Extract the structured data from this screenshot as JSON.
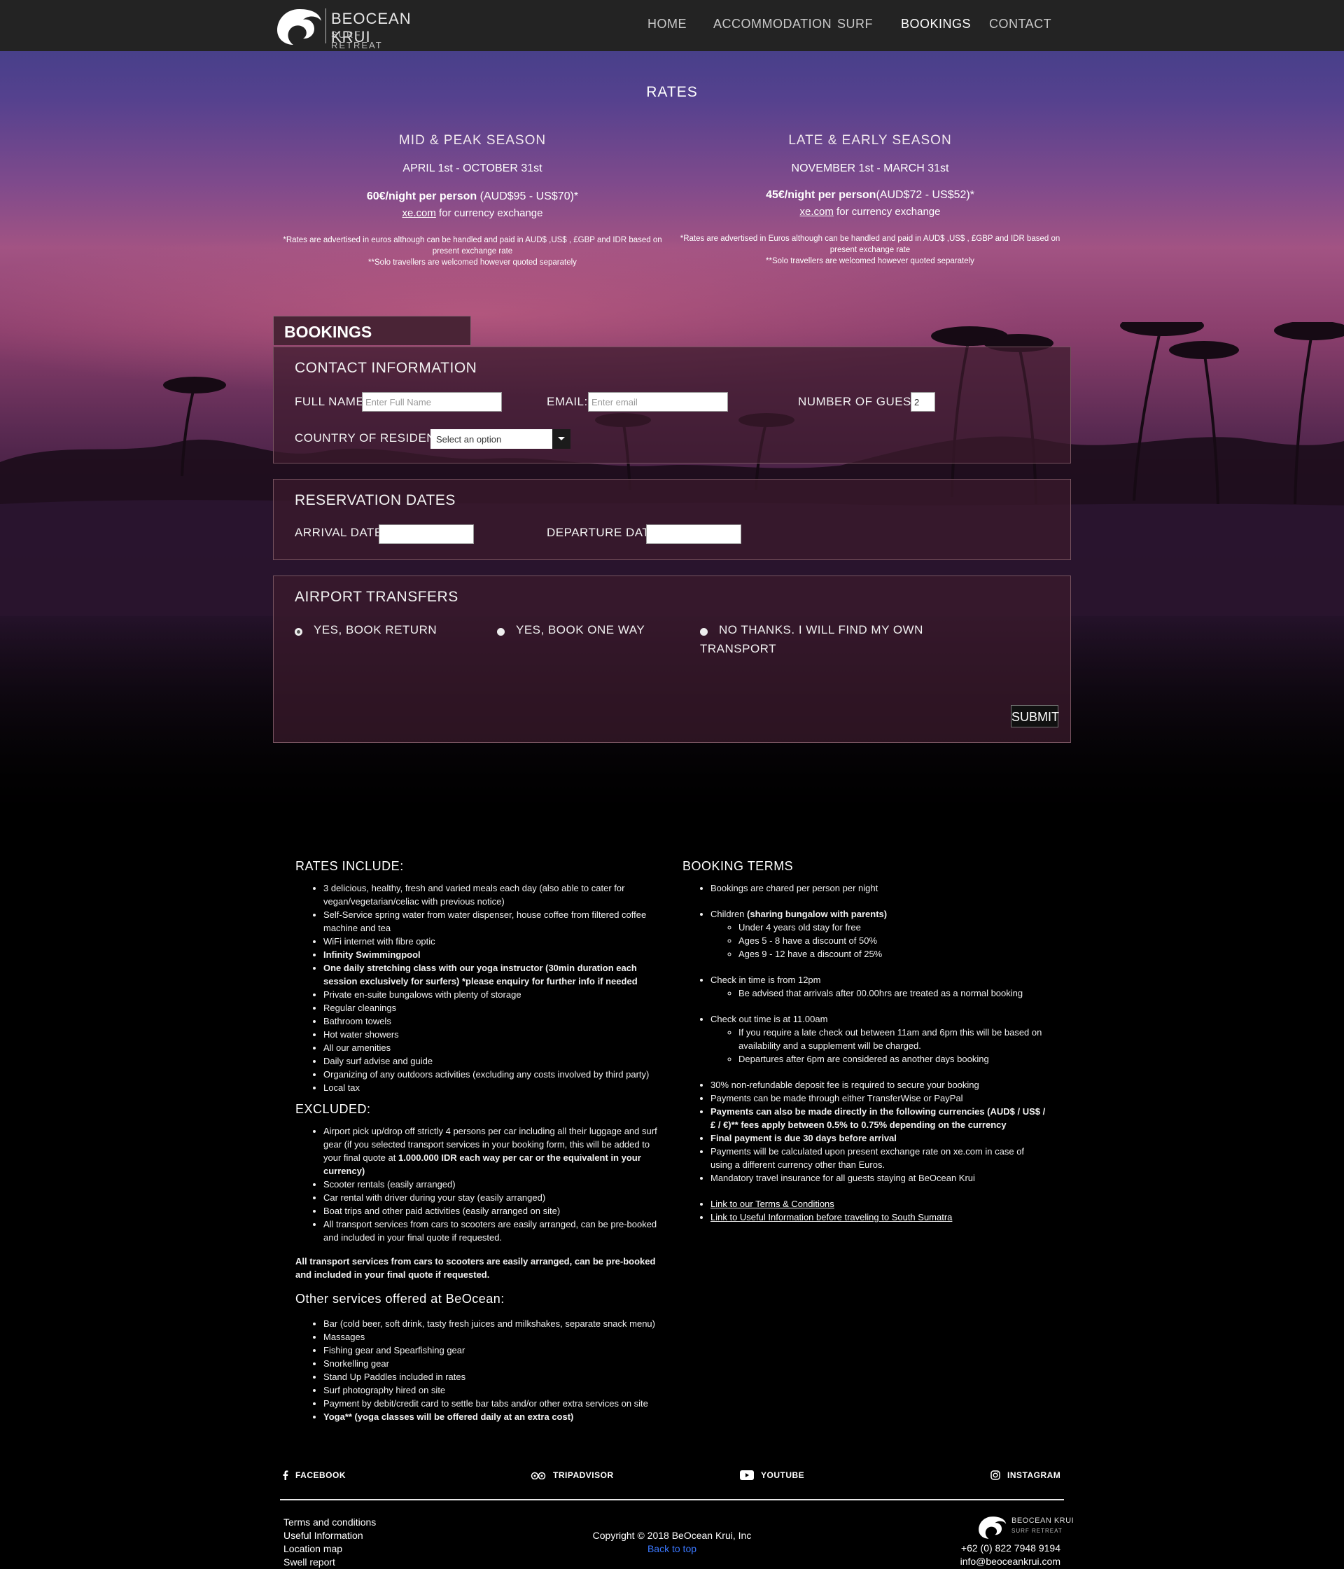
{
  "nav": {
    "brand": "BEOCEAN KRUI",
    "brand_sub": "SURF RETREAT",
    "items": [
      "HOME",
      "ACCOMMODATION",
      "SURF",
      "BOOKINGS",
      "CONTACT"
    ],
    "active": "BOOKINGS"
  },
  "rates": {
    "title": "RATES",
    "peak": {
      "name": "MID & PEAK SEASON",
      "dates": "APRIL 1st - OCTOBER 31st",
      "price_bold": "60€/night per person",
      "price_rest": " (AUD$95 - US$70)*",
      "xe_link": "xe.com",
      "xe_rest": " for currency exchange",
      "fine1": "*Rates are advertised in euros although can be handled and paid in AUD$ ,US$ , £GBP and IDR based on present exchange rate",
      "fine2": "**Solo travellers are welcomed however quoted separately"
    },
    "late": {
      "name": "LATE & EARLY SEASON",
      "dates": "NOVEMBER 1st - MARCH 31st",
      "price_bold": "45€/night per person",
      "price_rest": "(AUD$72 - US$52)*",
      "xe_link": "xe.com",
      "xe_rest": " for currency exchange",
      "fine1": "*Rates are advertised in Euros although can be handled and paid in AUD$ ,US$ , £GBP and IDR based on present exchange rate",
      "fine2": "**Solo travellers are welcomed however quoted separately"
    }
  },
  "form": {
    "tab": "BOOKINGS",
    "contact": {
      "title": "CONTACT INFORMATION",
      "full_name_label": "FULL NAME:",
      "full_name_placeholder": "Enter Full Name",
      "email_label": "EMAIL:",
      "email_placeholder": "Enter email",
      "guests_label": "NUMBER OF GUESTS:",
      "guests_value": "2",
      "country_label": "COUNTRY OF RESIDENCE:",
      "country_value": "Select an option"
    },
    "dates": {
      "title": "RESERVATION DATES",
      "arrival_label": "ARRIVAL DATE:",
      "departure_label": "DEPARTURE DATE:"
    },
    "transfers": {
      "title": "AIRPORT TRANSFERS",
      "opt1": "YES, BOOK RETURN",
      "opt2": "YES, BOOK ONE WAY",
      "opt3_line1": "NO THANKS. I WILL FIND MY OWN",
      "opt3_line2": "TRANSPORT",
      "selected": "YES, BOOK RETURN"
    },
    "submit": "SUBMIT"
  },
  "info": {
    "rates_include_title": "RATES INCLUDE:",
    "rates_include": [
      "3 delicious, healthy, fresh and varied meals each day (also able to cater for vegan/vegetarian/celiac with previous notice)",
      "Self-Service spring water from water dispenser, house coffee from filtered coffee machine and tea",
      "WiFi internet with fibre optic",
      "Infinity Swimmingpool",
      "One daily stretching class with our yoga instructor (30min duration each session exclusively for surfers) *please enquiry for further info if needed",
      "Private en-suite bungalows with plenty of storage",
      "Regular cleanings",
      "Bathroom towels",
      "Hot water showers",
      "All our amenities",
      "Daily surf advise and guide",
      "Organizing of any outdoors activities (excluding any costs involved by third party)",
      "Local tax"
    ],
    "excluded_title": "EXCLUDED:",
    "excluded_1a": "Airport pick up/drop off strictly 4 persons per car including all their luggage and surf gear (if you selected transport services in your booking form, this will be added to your final quote at ",
    "excluded_1b": "1.000.000 IDR each way per car or the equivalent in your currency)",
    "excluded": [
      "Scooter rentals (easily arranged)",
      "Car rental with driver during your stay (easily arranged)",
      "Boat trips and other paid activities (easily arranged on site)",
      "All transport services from cars to scooters are easily arranged, can be pre-booked and included in your final quote if requested."
    ],
    "transport_note": "All transport services from cars to scooters are easily arranged, can be pre-booked and included in your final quote if requested.",
    "other_title": "Other services offered at BeOcean:",
    "other": [
      "Bar (cold beer, soft drink, tasty fresh juices and milkshakes, separate snack menu)",
      "Massages",
      "Fishing gear and Spearfishing gear",
      "Snorkelling gear",
      "Stand Up Paddles included in rates",
      "Surf photography hired on site",
      "Payment by debit/credit card to settle bar tabs and/or other extra services on site"
    ],
    "yoga": "Yoga** (yoga classes will be offered daily at an extra cost)",
    "terms_title": "BOOKING TERMS",
    "terms": {
      "t1": "Bookings are chared per person per night",
      "children": "Children ",
      "children_b": "(sharing bungalow with parents)",
      "children_sub": [
        "Under 4 years old stay for free",
        "Ages 5 - 8 have a discount of 50%",
        "Ages 9 - 12 have a discount of 25%"
      ],
      "checkin": "Check in time is from 12pm",
      "checkin_sub": "Be advised that arrivals after 00.00hrs are treated as a normal booking",
      "checkout": "Check out time is at 11.00am",
      "checkout_sub": [
        "If you require a late check out between 11am and 6pm this will be based on availability and a supplement will be charged.",
        "Departures after 6pm are considered as another days booking"
      ],
      "deposit": "30% non-refundable deposit fee is required to secure your booking",
      "payments": "Payments can be made through either TransferWise or PayPal",
      "currencies": "Payments can also be made directly in the following currencies (AUD$ / US$ / £ / €)** fees apply between 0.5% to 0.75% depending on the currency",
      "final": "Final payment is due 30 days before arrival",
      "calc": "Payments will be calculated upon present exchange rate on xe.com in case of using a different currency other than Euros.",
      "insurance": "Mandatory travel insurance for all guests staying at BeOcean Krui",
      "link1": "Link to our Terms & Conditions",
      "link2": "Link to Useful Information before traveling to South Sumatra"
    }
  },
  "footer": {
    "social": [
      "FACEBOOK",
      "TRIPADVISOR",
      "YOUTUBE",
      "INSTAGRAM"
    ],
    "links": [
      "Terms and conditions",
      "Useful Information",
      "Location map",
      "Swell report"
    ],
    "copyright": "Copyright © 2018 BeOcean Krui, Inc",
    "back_to_top": "Back to top",
    "phone": "+62 (0) 822 7948 9194",
    "email": "info@beoceankrui.com",
    "brand": "BEOCEAN KRUI",
    "brand_sub": "SURF RETREAT"
  }
}
